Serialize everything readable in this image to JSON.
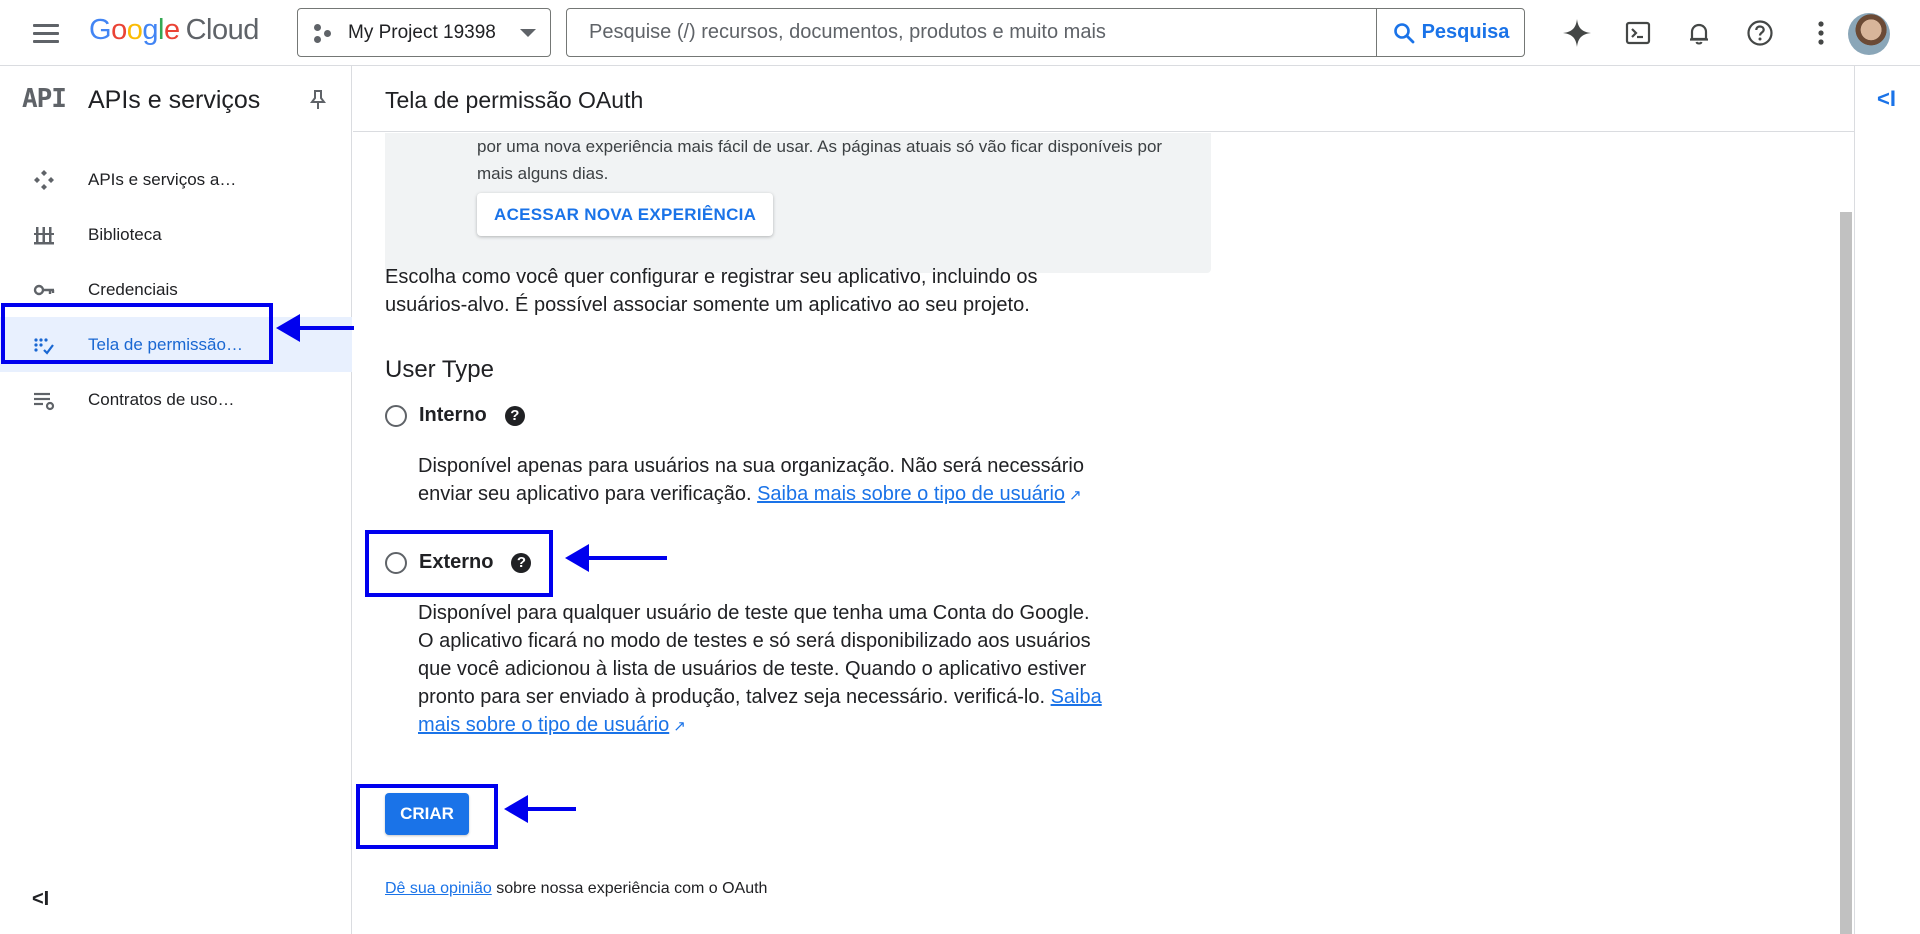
{
  "topbar": {
    "logo_letters": [
      "G",
      "o",
      "o",
      "g",
      "l",
      "e"
    ],
    "logo_cloud": "Cloud",
    "project_name": "My Project 19398",
    "search_placeholder": "Pesquise (/) recursos, documentos, produtos e muito mais",
    "search_button": "Pesquisa",
    "icons": [
      "gemini-sparkle-icon",
      "cloud-shell-icon",
      "notifications-icon",
      "help-icon",
      "more-vert-icon"
    ]
  },
  "sidebar": {
    "logo": "API",
    "title": "APIs e serviços",
    "items": [
      {
        "label": "APIs e serviços a…",
        "icon": "apis-services-icon",
        "active": false
      },
      {
        "label": "Biblioteca",
        "icon": "library-icon",
        "active": false
      },
      {
        "label": "Credenciais",
        "icon": "key-icon",
        "active": false
      },
      {
        "label": "Tela de permissão…",
        "icon": "consent-screen-icon",
        "active": true
      },
      {
        "label": "Contratos de uso…",
        "icon": "page-usage-agreements-icon",
        "active": false
      }
    ],
    "collapse_label": "<I"
  },
  "main": {
    "title": "Tela de permissão OAuth",
    "banner": {
      "text": "por uma nova experiência mais fácil de usar. As páginas atuais só vão ficar disponíveis por mais alguns dias.",
      "button": "ACESSAR NOVA EXPERIÊNCIA"
    },
    "intro": "Escolha como você quer configurar e registrar seu aplicativo, incluindo os usuários-alvo. É possível associar somente um aplicativo ao seu projeto.",
    "user_type_title": "User Type",
    "options": [
      {
        "label": "Interno",
        "desc": "Disponível apenas para usuários na sua organização. Não será necessário enviar seu aplicativo para verificação.",
        "link": "Saiba mais sobre o tipo de usuário"
      },
      {
        "label": "Externo",
        "desc": "Disponível para qualquer usuário de teste que tenha uma Conta do Google. O aplicativo ficará no modo de testes e só será disponibilizado aos usuários que você adicionou à lista de usuários de teste. Quando o aplicativo estiver pronto para ser enviado à produção, talvez seja necessário. verificá-lo.",
        "link": "Saiba mais sobre o tipo de usuário"
      }
    ],
    "create_button": "CRIAR",
    "feedback_link": "Dê sua opinião",
    "feedback_rest": " sobre nossa experiência com o OAuth"
  },
  "rail": {
    "toggle_label": "<I"
  },
  "colors": {
    "accent": "#1a73e8",
    "annotation": "#0000ee",
    "active_bg": "#e8f0fe"
  }
}
